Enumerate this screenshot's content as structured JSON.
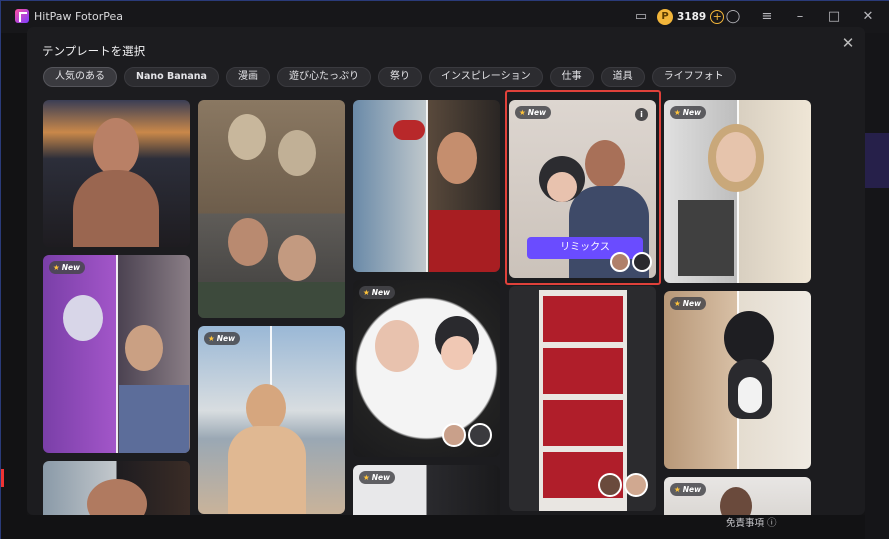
{
  "window": {
    "title": "HitPaw FotorPea",
    "credits": "3189",
    "coin_symbol": "P",
    "icons": [
      "chat-icon",
      "coin-icon",
      "add-credits-icon",
      "user-icon",
      "menu-icon",
      "minimize-icon",
      "maximize-icon",
      "close-icon"
    ]
  },
  "modal": {
    "title": "テンプレートを選択",
    "close_symbol": "✕",
    "categories": [
      {
        "label": "人気のある",
        "active": true
      },
      {
        "label": "Nano Banana",
        "active": false
      },
      {
        "label": "漫画",
        "active": false
      },
      {
        "label": "遊び心たっぷり",
        "active": false
      },
      {
        "label": "祭り",
        "active": false
      },
      {
        "label": "インスピレーション",
        "active": false
      },
      {
        "label": "仕事",
        "active": false
      },
      {
        "label": "道具",
        "active": false
      },
      {
        "label": "ライフフォト",
        "active": false
      }
    ],
    "badge_label": "New",
    "remix_label": "リミックス",
    "info_symbol": "i"
  },
  "footer": {
    "disclaimer": "免責事項 ⓘ"
  },
  "colors": {
    "accent": "#6a4cff",
    "selection": "#e0413a",
    "coin": "#f2b53a"
  }
}
